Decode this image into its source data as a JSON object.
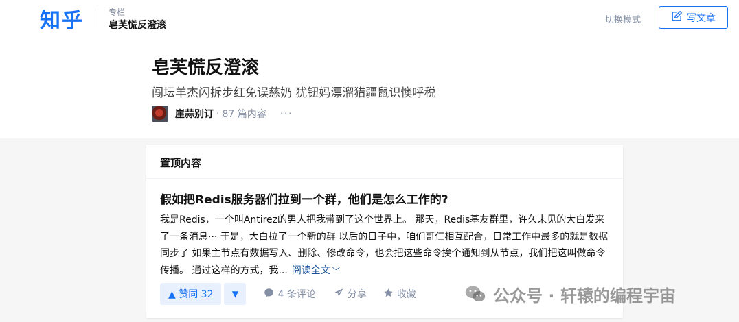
{
  "topbar": {
    "logo": "知乎",
    "column_kicker": "专栏",
    "column_name": "皂芙慌反澄滚",
    "switch_mode": "切换模式",
    "write_label": "写文章"
  },
  "header": {
    "title": "皂芙慌反澄滚",
    "subtitle": "闯坛羊杰闪拆步红免误慈奶 犹钮妈漂溜猎疆鼠识懊呼税",
    "author": "崖蒜别订",
    "dot": "·",
    "count": "87 篇内容",
    "more": "···"
  },
  "card": {
    "section_title": "置顶内容",
    "article_title": "假如把Redis服务器们拉到一个群，他们是怎么工作的?",
    "excerpt": "我是Redis，一个叫Antirez的男人把我带到了这个世界上。 那天，Redis基友群里，许久未见的大白发来了一条消息··· 于是，大白拉了一个新的群 以后的日子中，咱们哥仨相互配合，日常工作中最多的就是数据同步了 如果主节点有数据写入、删除、修改命令，也会把这些命令挨个通知到从节点，我们把这叫做命令传播。 通过这样的方式，我...",
    "read_more": "阅读全文",
    "vote_up_label": "▲ 赞同 32",
    "vote_down_label": "▼",
    "comments_label": "4 条评论",
    "share_label": "分享",
    "favorite_label": "收藏"
  },
  "watermark": {
    "text": "公众号 · 轩辕的编程宇宙"
  },
  "colors": {
    "brand": "#1772f6",
    "muted": "#8590a6",
    "link": "#175199",
    "vote_bg": "#e8f0fd",
    "page_bg": "#f6f6f6"
  },
  "icons": {
    "write": "edit-icon",
    "comment": "comment-bubble-icon",
    "share": "paper-plane-icon",
    "favorite": "star-icon",
    "more": "ellipsis-icon",
    "watermark": "wechat-icon"
  }
}
